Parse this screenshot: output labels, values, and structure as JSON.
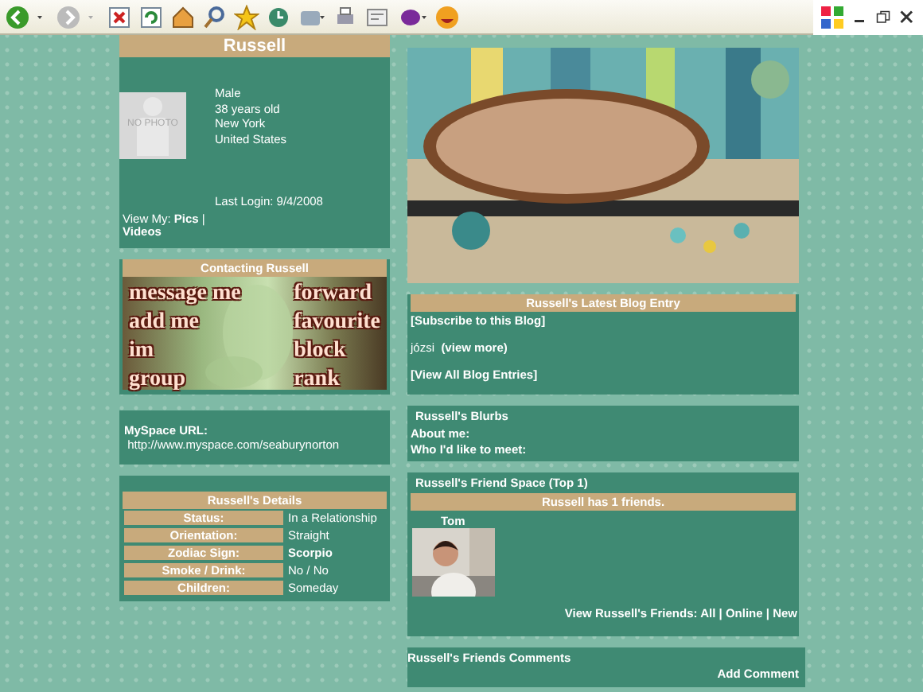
{
  "profile": {
    "name": "Russell",
    "photo_placeholder": "NO PHOTO",
    "info": [
      "Male",
      "38 years old",
      "New York",
      "United States"
    ],
    "last_login": "Last Login: 9/4/2008",
    "view_my_label": "View My:",
    "links": [
      "Pics",
      "Videos"
    ],
    "separator": "|"
  },
  "contacting": {
    "title": "Contacting Russell",
    "left": [
      "message me",
      "add me",
      "im",
      "group"
    ],
    "right": [
      "forward",
      "favourite",
      "block",
      "rank"
    ]
  },
  "url": {
    "label": "MySpace URL:",
    "address": "http://www.myspace.com/seaburynorton"
  },
  "details": {
    "title": "Russell's Details",
    "rows": [
      {
        "label": "Status:",
        "value": "In a Relationship",
        "bold": false
      },
      {
        "label": "Orientation:",
        "value": "Straight",
        "bold": false
      },
      {
        "label": "Zodiac Sign:",
        "value": "Scorpio",
        "bold": true
      },
      {
        "label": "Smoke / Drink:",
        "value": "No / No",
        "bold": false
      },
      {
        "label": "Children:",
        "value": "Someday",
        "bold": false
      }
    ]
  },
  "blog": {
    "title": "Russell's Latest Blog Entry",
    "subscribe": "[Subscribe to this Blog]",
    "entry": "józsi",
    "view_more": "(view more)",
    "view_all": "[View All Blog Entries]"
  },
  "blurbs": {
    "title": "Russell's Blurbs",
    "items": [
      "About me:",
      "Who I'd like to meet:"
    ]
  },
  "friends": {
    "title": "Russell's Friend Space (Top 1)",
    "count": "Russell has 1 friends.",
    "friends": [
      {
        "name": "Tom"
      }
    ],
    "view_label": "View Russell's Friends:",
    "links": [
      "All",
      "Online",
      "New"
    ],
    "separator": "|"
  },
  "comments": {
    "title": "Russell's Friends Comments",
    "add": "Add Comment"
  }
}
